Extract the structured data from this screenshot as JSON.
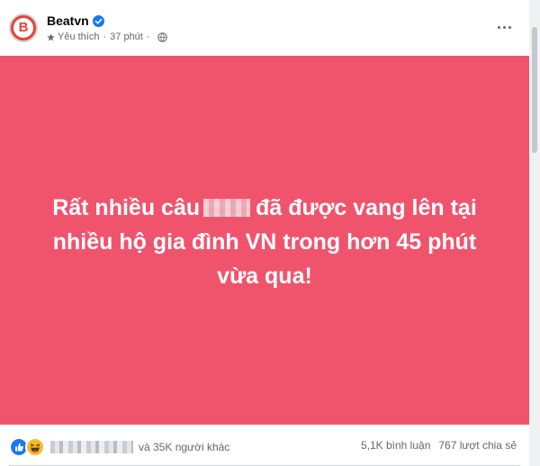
{
  "post": {
    "page_name": "Beatvn",
    "follow_label": "Yêu thích",
    "separator": "·",
    "time": "37 phút",
    "avatar_letter": "B",
    "text_line1_before": "Rất nhiều câu",
    "text_line1_after": "đã được vang lên tại",
    "text_line2": "nhiều hộ gia đình VN trong hơn 45 phút",
    "text_line3": "vừa qua!",
    "background_color": "#f0546d"
  },
  "footer": {
    "reactions": [
      "like",
      "haha"
    ],
    "others_text": "và 35K người khác",
    "comments": "5,1K bình luận",
    "shares": "767 lượt chia sẻ"
  },
  "colors": {
    "verified_badge": "#1877f2",
    "like": "#1877f2",
    "haha": "#f7b928"
  }
}
